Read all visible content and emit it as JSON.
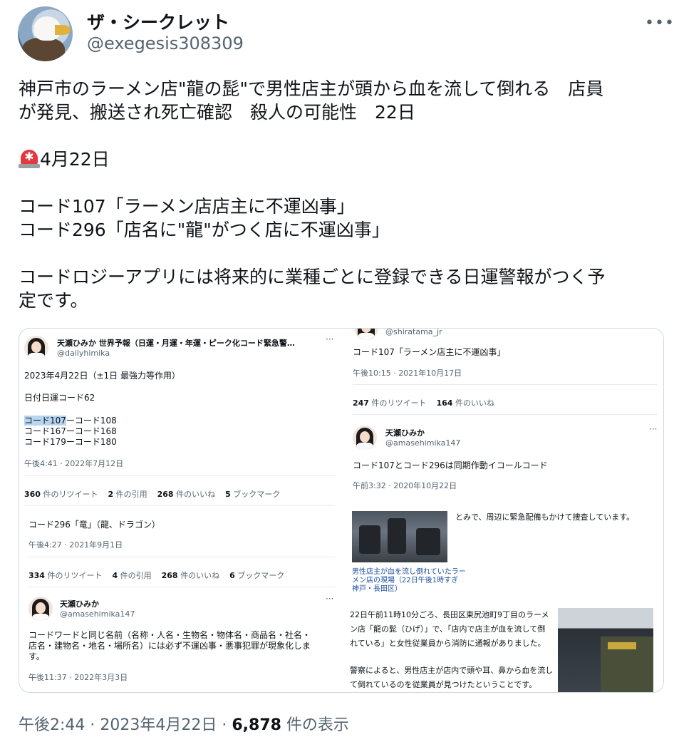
{
  "author": {
    "display_name": "ザ・シークレット",
    "handle": "@exegesis308309"
  },
  "more_icon": "more-horizontal-icon",
  "tweet": {
    "line1": "神戸市のラーメン店\"龍の髭\"で男性店主が頭から血を流して倒れる　店員",
    "line2": "が発見、搬送され死亡確認　殺人の可能性　22日",
    "date_line": "4月22日",
    "code1": "コード107「ラーメン店店主に不運凶事」",
    "code2": "コード296「店名に\"龍\"がつく店に不運凶事」",
    "line5": "コードロジーアプリには将来的に業種ごとに登録できる日運警報がつく予",
    "line6": "定です。",
    "siren_icon": "siren-icon"
  },
  "media": {
    "left": {
      "t1_name": "天瀬ひみか 世界予報（日運・月運・年運・ピーク化コード緊急警…",
      "t1_handle": "@dailyhimika",
      "t1_l1": "2023年4月22日（±1日 最強力等作用）",
      "t1_l2": "日付日運コード62",
      "t1_l3a": "コード107",
      "t1_l3b": "ーコード108",
      "t1_l4": "コード167ーコード168",
      "t1_l5": "コード179ーコード180",
      "t1_time": "午後4:41 · 2022年7月12日",
      "t1_rt": "360",
      "t1_rt_label": "件のリツイート",
      "t1_q": "2",
      "t1_q_label": "件の引用",
      "t1_like": "268",
      "t1_like_label": "件のいいね",
      "t1_bm": "5",
      "t1_bm_label": "ブックマーク",
      "t2_text": "コード296「竜」（龍、ドラゴン）",
      "t2_time": "午後4:27 · 2021年9月1日",
      "t2_rt": "334",
      "t2_rt_label": "件のリツイート",
      "t2_q": "4",
      "t2_q_label": "件の引用",
      "t2_like": "268",
      "t2_like_label": "件のいいね",
      "t2_bm": "6",
      "t2_bm_label": "ブックマーク",
      "t3_name": "天瀬ひみか",
      "t3_handle": "@amasehimika147",
      "t3_l1": "コードワードと同じ名前（名称・人名・生物名・物体名・商品名・社名・",
      "t3_l2": "店名・建物名・地名・場所名）には必ず不運凶事・悪事犯罪が現象化しま",
      "t3_l3": "す。",
      "t3_time": "午後11:37 · 2022年3月3日"
    },
    "right": {
      "r0_handle": "@shiratama_jr",
      "r0_text": "コード107「ラーメン店主に不運凶事」",
      "r0_time": "午後10:15 · 2021年10月17日",
      "r0_rt": "247",
      "r0_rt_label": "件のリツイート",
      "r0_like": "164",
      "r0_like_label": "件のいいね",
      "r1_name": "天瀬ひみか",
      "r1_handle": "@amasehimika147",
      "r1_text": "コード107とコード296は同期作動イコールコード",
      "r1_time": "午前3:32 · 2020年10月22日",
      "news1_text": "とみで、周辺に緊急配備もかけて捜査しています。",
      "cap1": "男性店主が血を流し倒れていたラー",
      "cap2": "メン店の現場（22日午後1時すぎ",
      "cap3": "神戸・長田区）",
      "news2_l1": "22日午前11時10分ごろ、長田区東尻池町9丁目のラーメ",
      "news2_l2": "ン店「龍の髭（ひげ）」で、「店内で店主が血を流して倒",
      "news2_l3": "れている」と女性従業員から消防に通報がありました。",
      "news3_l1": "警察によると、男性店主が店内で頭や耳、鼻から血を流し",
      "news3_l2": "て倒れているのを従業員が見つけたということです。"
    }
  },
  "footer": {
    "time": "午後2:44 · 2023年4月22日 · ",
    "views": "6,878",
    "views_label": " 件の表示"
  }
}
